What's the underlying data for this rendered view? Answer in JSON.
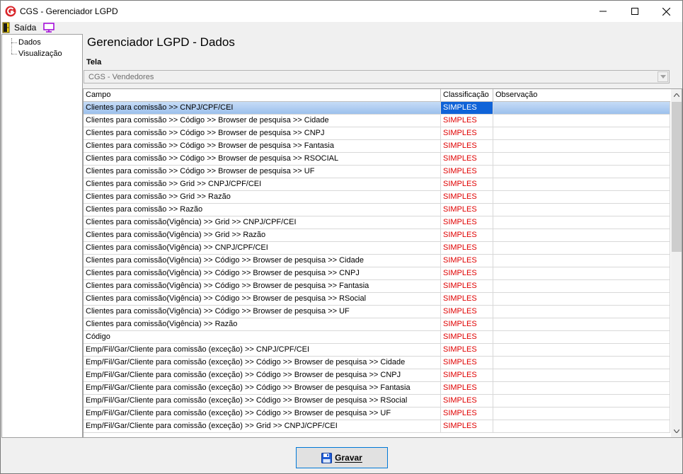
{
  "window": {
    "title": "CGS - Gerenciador LGPD"
  },
  "menu": {
    "exit_label": "Saída",
    "exit_icon": "door-exit-icon",
    "view_icon": "monitor-icon"
  },
  "tree": {
    "items": [
      {
        "label": "Dados"
      },
      {
        "label": "Visualização"
      }
    ]
  },
  "main": {
    "heading": "Gerenciador LGPD - Dados",
    "screen_label": "Tela",
    "screen_value": "CGS - Vendedores"
  },
  "grid": {
    "columns": [
      "Campo",
      "Classificação",
      "Observação"
    ],
    "rows": [
      {
        "campo": "Clientes para comissão >> CNPJ/CPF/CEI",
        "classificacao": "SIMPLES",
        "observacao": ""
      },
      {
        "campo": "Clientes para comissão >> Código >> Browser de pesquisa >> Cidade",
        "classificacao": "SIMPLES",
        "observacao": ""
      },
      {
        "campo": "Clientes para comissão >> Código >> Browser de pesquisa >> CNPJ",
        "classificacao": "SIMPLES",
        "observacao": ""
      },
      {
        "campo": "Clientes para comissão >> Código >> Browser de pesquisa >> Fantasia",
        "classificacao": "SIMPLES",
        "observacao": ""
      },
      {
        "campo": "Clientes para comissão >> Código >> Browser de pesquisa >> RSOCIAL",
        "classificacao": "SIMPLES",
        "observacao": ""
      },
      {
        "campo": "Clientes para comissão >> Código >> Browser de pesquisa >> UF",
        "classificacao": "SIMPLES",
        "observacao": ""
      },
      {
        "campo": "Clientes para comissão >> Grid >> CNPJ/CPF/CEI",
        "classificacao": "SIMPLES",
        "observacao": ""
      },
      {
        "campo": "Clientes para comissão >> Grid >> Razão",
        "classificacao": "SIMPLES",
        "observacao": ""
      },
      {
        "campo": "Clientes para comissão >> Razão",
        "classificacao": "SIMPLES",
        "observacao": ""
      },
      {
        "campo": "Clientes para comissão(Vigência)  >> Grid >> CNPJ/CPF/CEI",
        "classificacao": "SIMPLES",
        "observacao": ""
      },
      {
        "campo": "Clientes para comissão(Vigência)  >> Grid >> Razão",
        "classificacao": "SIMPLES",
        "observacao": ""
      },
      {
        "campo": "Clientes para comissão(Vigência) >> CNPJ/CPF/CEI",
        "classificacao": "SIMPLES",
        "observacao": ""
      },
      {
        "campo": "Clientes para comissão(Vigência) >> Código >> Browser de pesquisa >> Cidade",
        "classificacao": "SIMPLES",
        "observacao": ""
      },
      {
        "campo": "Clientes para comissão(Vigência) >> Código >> Browser de pesquisa >> CNPJ",
        "classificacao": "SIMPLES",
        "observacao": ""
      },
      {
        "campo": "Clientes para comissão(Vigência) >> Código >> Browser de pesquisa >> Fantasia",
        "classificacao": "SIMPLES",
        "observacao": ""
      },
      {
        "campo": "Clientes para comissão(Vigência) >> Código >> Browser de pesquisa >> RSocial",
        "classificacao": "SIMPLES",
        "observacao": ""
      },
      {
        "campo": "Clientes para comissão(Vigência) >> Código >> Browser de pesquisa >> UF",
        "classificacao": "SIMPLES",
        "observacao": ""
      },
      {
        "campo": "Clientes para comissão(Vigência) >> Razão",
        "classificacao": "SIMPLES",
        "observacao": ""
      },
      {
        "campo": "Código",
        "classificacao": "SIMPLES",
        "observacao": ""
      },
      {
        "campo": "Emp/Fil/Gar/Cliente para comissão (exceção) >> CNPJ/CPF/CEI",
        "classificacao": "SIMPLES",
        "observacao": ""
      },
      {
        "campo": "Emp/Fil/Gar/Cliente para comissão (exceção) >> Código >> Browser de pesquisa >> Cidade",
        "classificacao": "SIMPLES",
        "observacao": ""
      },
      {
        "campo": "Emp/Fil/Gar/Cliente para comissão (exceção) >> Código >> Browser de pesquisa >> CNPJ",
        "classificacao": "SIMPLES",
        "observacao": ""
      },
      {
        "campo": "Emp/Fil/Gar/Cliente para comissão (exceção) >> Código >> Browser de pesquisa >> Fantasia",
        "classificacao": "SIMPLES",
        "observacao": ""
      },
      {
        "campo": "Emp/Fil/Gar/Cliente para comissão (exceção) >> Código >> Browser de pesquisa >> RSocial",
        "classificacao": "SIMPLES",
        "observacao": ""
      },
      {
        "campo": "Emp/Fil/Gar/Cliente para comissão (exceção) >> Código >> Browser de pesquisa >> UF",
        "classificacao": "SIMPLES",
        "observacao": ""
      },
      {
        "campo": "Emp/Fil/Gar/Cliente para comissão (exceção) >> Grid >> CNPJ/CPF/CEI",
        "classificacao": "SIMPLES",
        "observacao": ""
      }
    ],
    "selected_row": 0
  },
  "footer": {
    "save_label": "Gravar",
    "save_icon": "floppy-disk-icon"
  },
  "colors": {
    "accent": "#0078d7",
    "selection": "#0f63d8",
    "classification_text": "#e00000",
    "logo": "#d9252a"
  }
}
